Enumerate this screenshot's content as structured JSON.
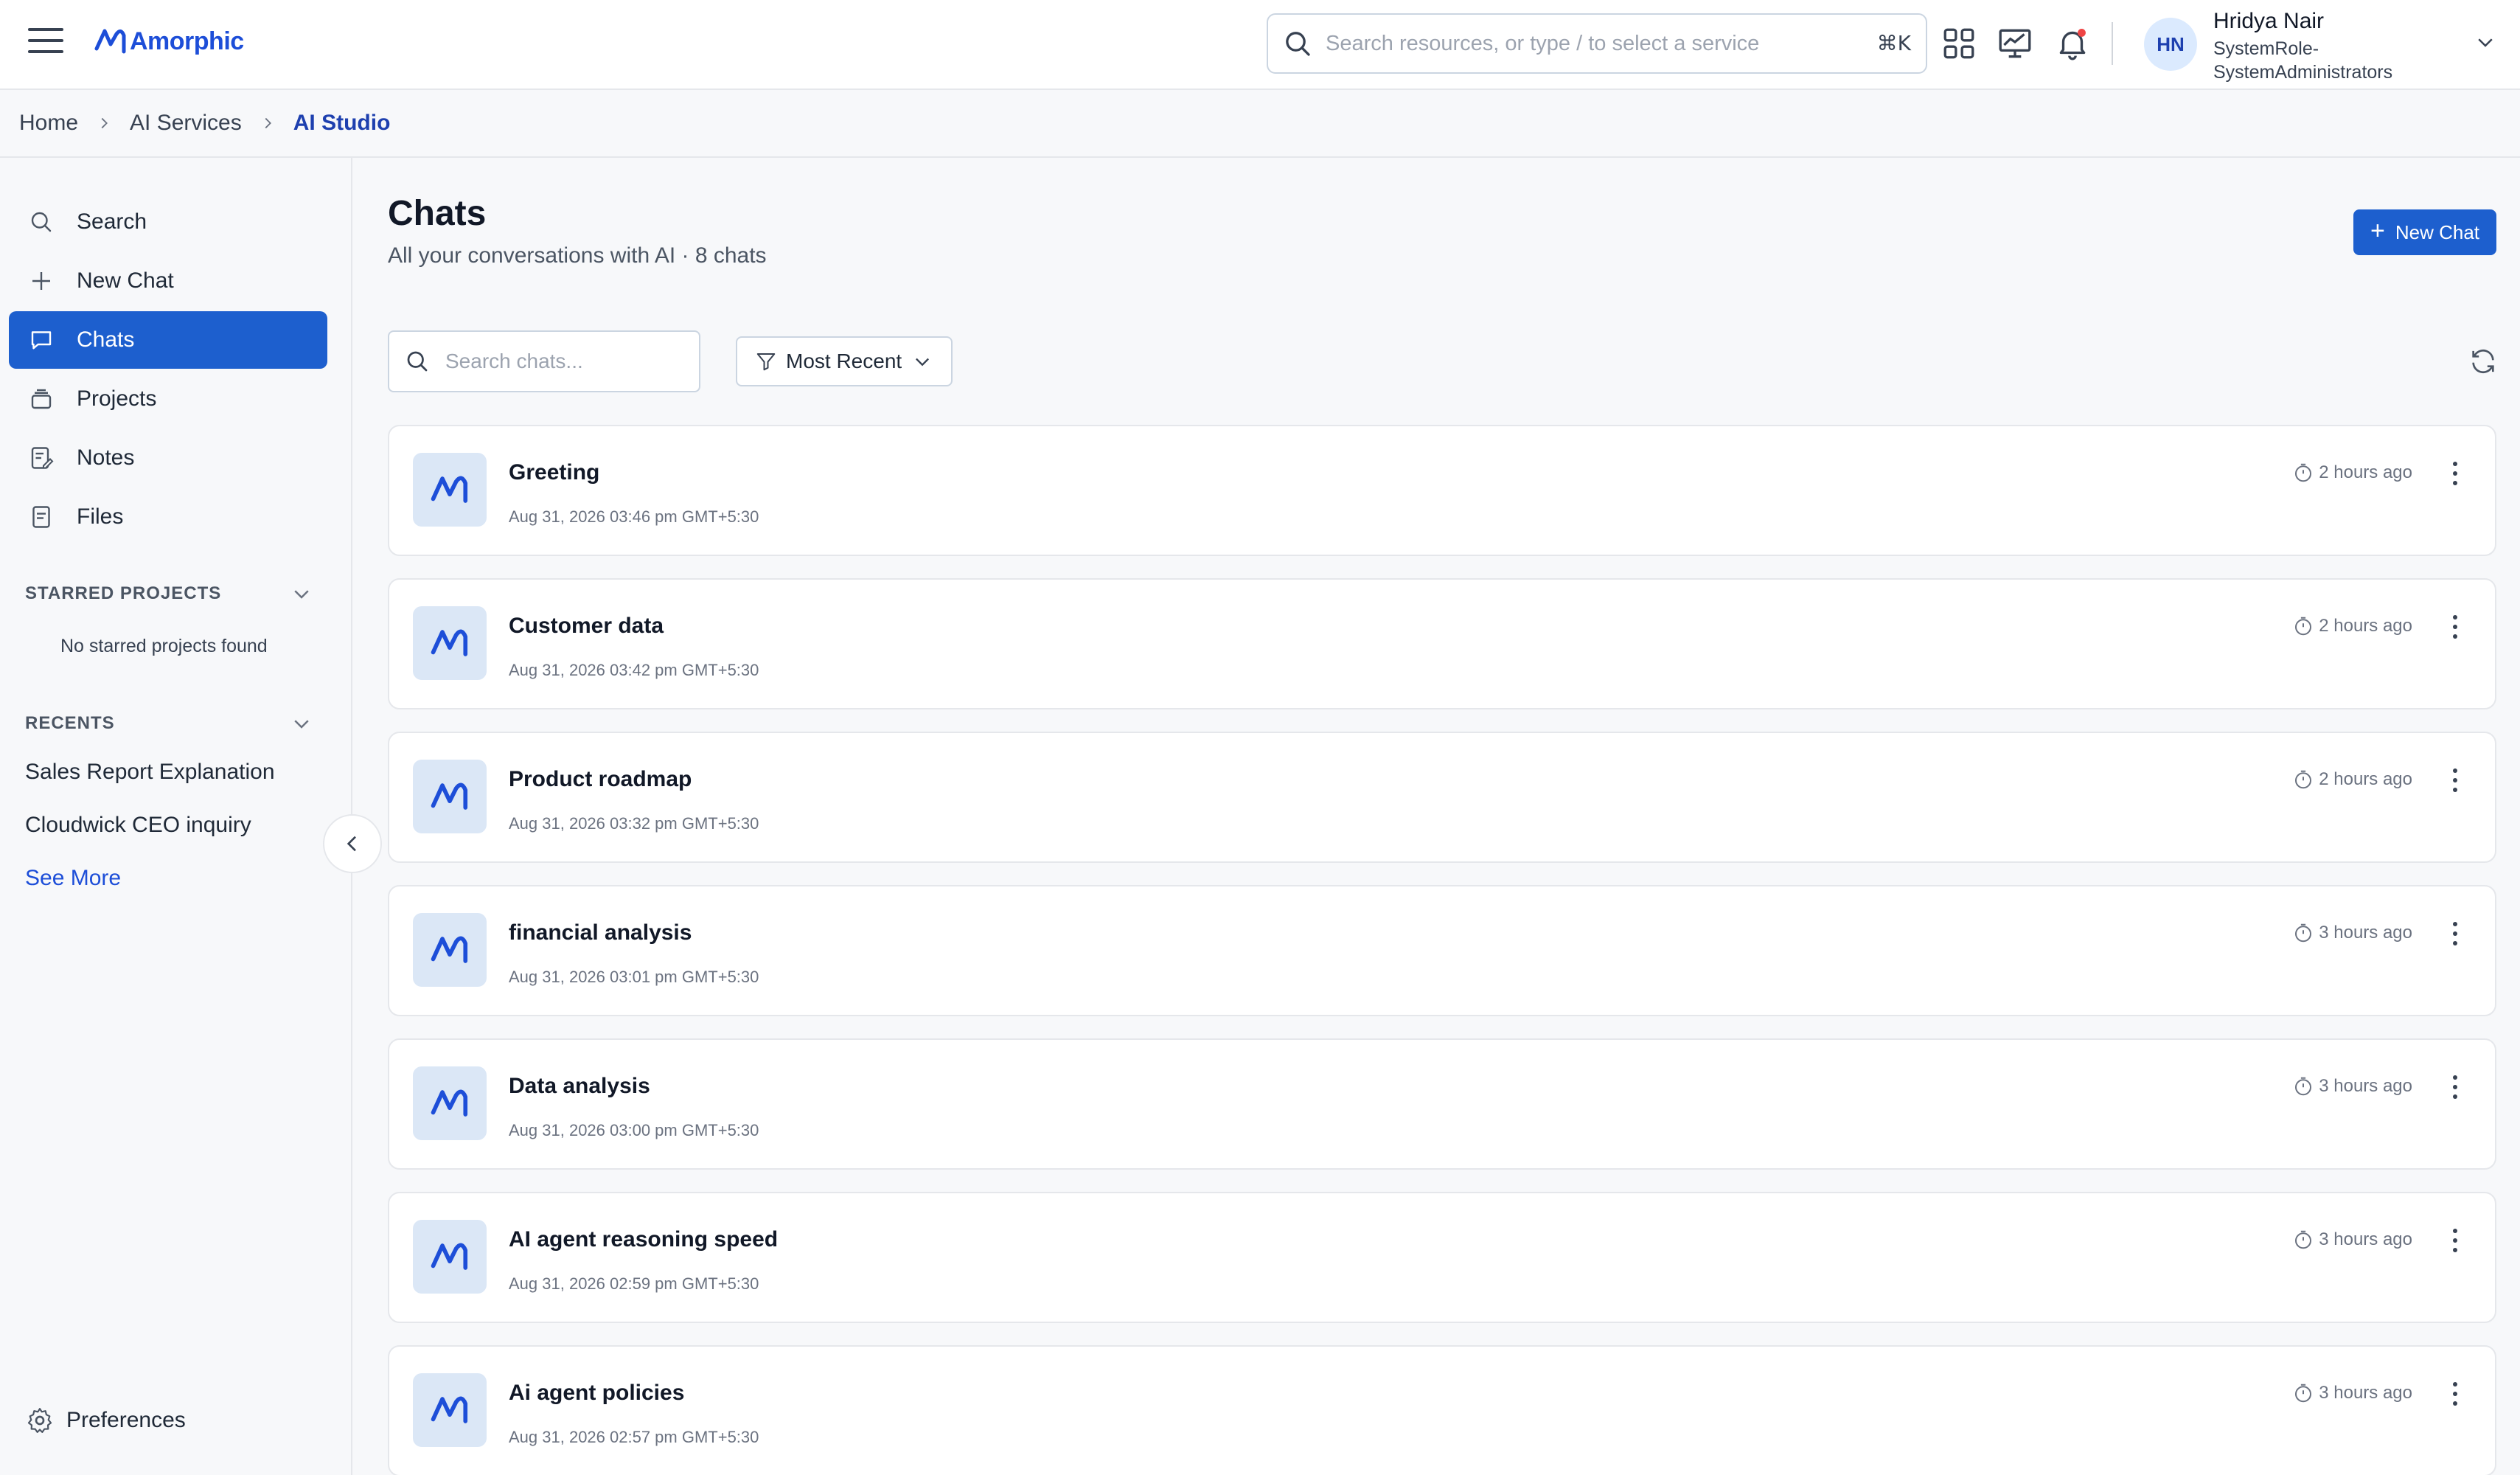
{
  "app": {
    "logo_text": "Amorphic",
    "brand_color": "#1d5fce"
  },
  "header": {
    "search_placeholder": "Search resources, or type / to select a service",
    "shortcut": "⌘K",
    "user": {
      "initials": "HN",
      "name": "Hridya Nair",
      "role": "SystemRole-SystemAdministrators"
    },
    "icons": [
      "apps-grid-icon",
      "analytics-icon",
      "bell-icon"
    ]
  },
  "breadcrumb": {
    "items": [
      "Home",
      "AI Services",
      "AI Studio"
    ]
  },
  "sidebar": {
    "nav": [
      {
        "label": "Search",
        "icon": "search-icon"
      },
      {
        "label": "New Chat",
        "icon": "plus-icon"
      },
      {
        "label": "Chats",
        "icon": "chat-bubble-icon",
        "active": true
      },
      {
        "label": "Projects",
        "icon": "projects-icon"
      },
      {
        "label": "Notes",
        "icon": "notes-icon"
      },
      {
        "label": "Files",
        "icon": "file-icon"
      }
    ],
    "starred": {
      "heading": "STARRED PROJECTS",
      "empty": "No starred projects found"
    },
    "recents": {
      "heading": "RECENTS",
      "items": [
        "Sales Report Explanation",
        "Cloudwick CEO inquiry"
      ],
      "see_more": "See More"
    },
    "preferences": "Preferences"
  },
  "main": {
    "title": "Chats",
    "subtitle": "All your conversations with AI · 8 chats",
    "new_chat_label": "New Chat",
    "search_placeholder": "Search chats...",
    "sort_label": "Most Recent",
    "chats": [
      {
        "title": "Greeting",
        "date": "Aug 31, 2026 03:46 pm GMT+5:30",
        "ago": "2 hours ago"
      },
      {
        "title": "Customer data",
        "date": "Aug 31, 2026 03:42 pm GMT+5:30",
        "ago": "2 hours ago"
      },
      {
        "title": "Product roadmap",
        "date": "Aug 31, 2026 03:32 pm GMT+5:30",
        "ago": "2 hours ago"
      },
      {
        "title": "financial analysis",
        "date": "Aug 31, 2026 03:01 pm GMT+5:30",
        "ago": "3 hours ago"
      },
      {
        "title": "Data analysis",
        "date": "Aug 31, 2026 03:00 pm GMT+5:30",
        "ago": "3 hours ago"
      },
      {
        "title": "AI agent reasoning speed",
        "date": "Aug 31, 2026 02:59 pm GMT+5:30",
        "ago": "3 hours ago"
      },
      {
        "title": "Ai agent policies",
        "date": "Aug 31, 2026 02:57 pm GMT+5:30",
        "ago": "3 hours ago"
      }
    ]
  }
}
